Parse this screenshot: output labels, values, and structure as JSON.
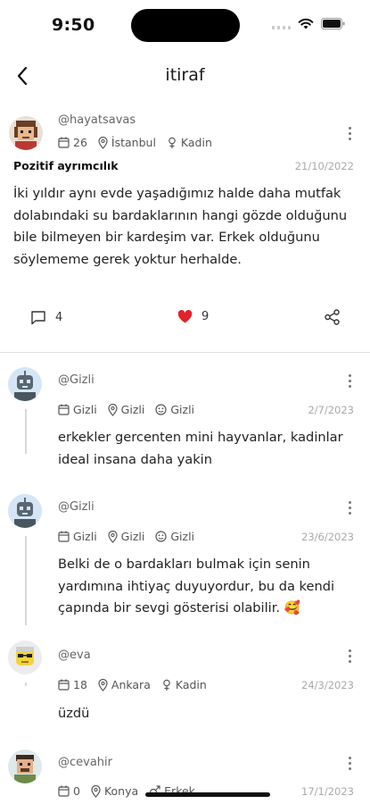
{
  "status": {
    "time": "9:50"
  },
  "nav": {
    "title": "itiraf"
  },
  "post": {
    "username": "@hayatsavas",
    "age": "26",
    "location": "İstanbul",
    "gender": "Kadin",
    "category": "Pozitif ayrımcılık",
    "date": "21/10/2022",
    "text": "İki yıldır aynı evde yaşadığımız halde daha mutfak dolabındaki su bardaklarının hangi gözde olduğunu bile bilmeyen bir kardeşim var. Erkek olduğunu söylememe gerek yoktur herhalde.",
    "comment_count": "4",
    "like_count": "9"
  },
  "comments": [
    {
      "username": "@Gizli",
      "age": "Gizli",
      "location": "Gizli",
      "gender": "Gizli",
      "date": "2/7/2023",
      "text": "erkekler gercenten mini hayvanlar, kadinlar ideal insana daha yakin"
    },
    {
      "username": "@Gizli",
      "age": "Gizli",
      "location": "Gizli",
      "gender": "Gizli",
      "date": "23/6/2023",
      "text": "Belki de o bardakları bulmak için senin yardımına ihtiyaç duyuyordur, bu da kendi çapında bir sevgi gösterisi olabilir. 🥰"
    },
    {
      "username": "@eva",
      "age": "18",
      "location": "Ankara",
      "gender": "Kadin",
      "date": "24/3/2023",
      "text": "üzdü"
    },
    {
      "username": "@cevahir",
      "age": "0",
      "location": "Konya",
      "gender": "Erkek",
      "date": "17/1/2023",
      "text": ""
    }
  ],
  "colors": {
    "like": "#e0242c",
    "divider": "#e0e0e0",
    "date": "#aaaaaa"
  }
}
